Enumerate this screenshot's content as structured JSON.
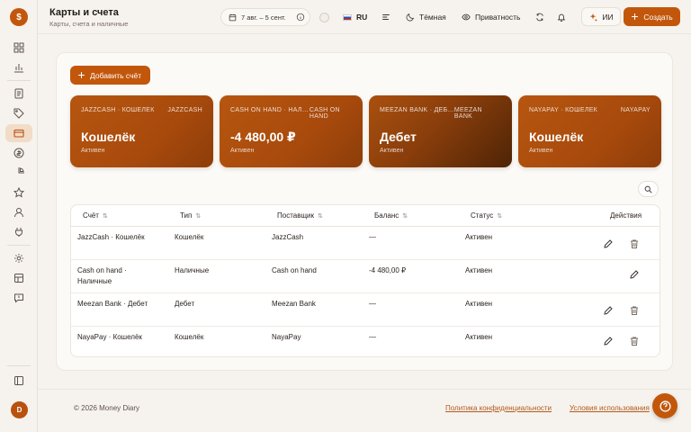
{
  "header": {
    "title": "Карты и счета",
    "subtitle": "Карты, счета и наличные",
    "date_range": "7 авг. – 5 сент.",
    "language": "RU",
    "theme_label": "Тёмная",
    "privacy_label": "Приватность",
    "ai_label": "ИИ",
    "create_label": "Создать"
  },
  "main": {
    "add_account_label": "Добавить счёт"
  },
  "cards": [
    {
      "provider_line": "JAZZCASH · КОШЕЛЁК",
      "provider": "JAZZCASH",
      "title": "Кошелёк",
      "status": "Активен"
    },
    {
      "provider_line": "CASH ON HAND · НАЛИЧНЫЕ",
      "provider": "CASH ON HAND",
      "title": "-4 480,00 ₽",
      "status": "Активен"
    },
    {
      "provider_line": "MEEZAN BANK · ДЕБЕТ",
      "provider": "MEEZAN BANK",
      "title": "Дебет",
      "status": "Активен"
    },
    {
      "provider_line": "NAYAPAY · КОШЕЛЁК",
      "provider": "NAYAPAY",
      "title": "Кошелёк",
      "status": "Активен"
    }
  ],
  "table": {
    "columns": [
      "Счёт",
      "Тип",
      "Поставщик",
      "Баланс",
      "Статус",
      "Действия"
    ],
    "rows": [
      {
        "account": "JazzCash · Кошелёк",
        "type": "Кошелёк",
        "provider": "JazzCash",
        "balance": "—",
        "status": "Активен"
      },
      {
        "account": "Cash on hand · Наличные",
        "type": "Наличные",
        "provider": "Cash on hand",
        "balance": "-4 480,00 ₽",
        "status": "Активен"
      },
      {
        "account": "Meezan Bank · Дебет",
        "type": "Дебет",
        "provider": "Meezan Bank",
        "balance": "—",
        "status": "Активен"
      },
      {
        "account": "NayaPay · Кошелёк",
        "type": "Кошелёк",
        "provider": "NayaPay",
        "balance": "—",
        "status": "Активен"
      }
    ]
  },
  "footer": {
    "copyright": "© 2026 Money Diary",
    "privacy_link": "Политика конфиденциальности",
    "terms_link": "Условия использования"
  },
  "user": {
    "initial": "D"
  },
  "colors": {
    "accent": "#c2570c",
    "card_dark": "#5a2a06",
    "background": "#f6f3ee"
  }
}
